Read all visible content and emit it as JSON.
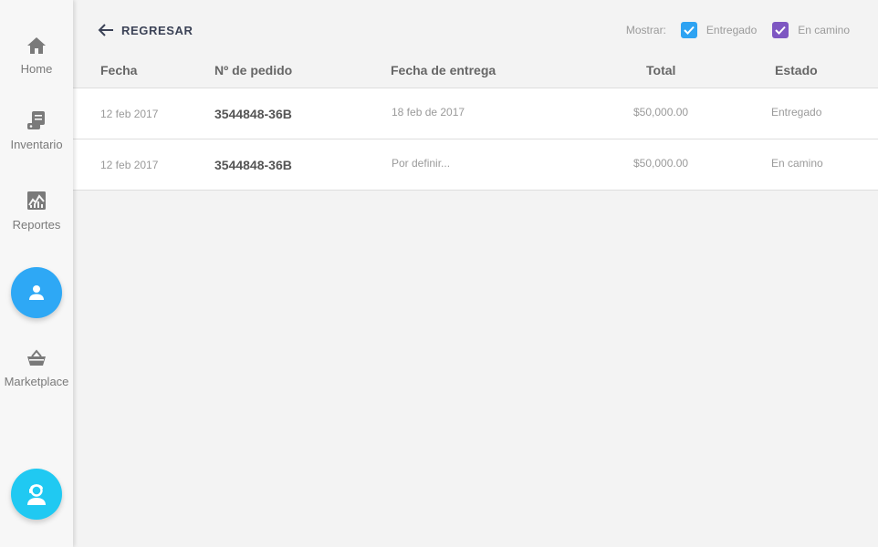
{
  "sidebar": {
    "items": [
      {
        "label": "Home",
        "icon": "home-icon"
      },
      {
        "label": "Inventario",
        "icon": "inventory-icon"
      },
      {
        "label": "Reportes",
        "icon": "reports-icon"
      },
      {
        "label": "Marketplace",
        "icon": "basket-icon"
      }
    ],
    "profile_button": {
      "icon": "person-icon",
      "color": "#2ea8f5"
    },
    "support_button": {
      "icon": "support-agent-icon",
      "color": "#20c9f2"
    }
  },
  "toolbar": {
    "back_label": "REGRESAR",
    "filter_label": "Mostrar:",
    "filters": [
      {
        "label": "Entregado",
        "checked": true,
        "color": "#2ea3f2"
      },
      {
        "label": "En camino",
        "checked": true,
        "color": "#7e57c2"
      }
    ]
  },
  "table": {
    "columns": [
      "Fecha",
      "Nº de pedido",
      "Fecha de entrega",
      "Total",
      "Estado"
    ],
    "rows": [
      {
        "fecha": "12 feb 2017",
        "pedido": "3544848-36B",
        "entrega": "18 feb de 2017",
        "total": "$50,000.00",
        "estado": "Entregado"
      },
      {
        "fecha": "12 feb 2017",
        "pedido": "3544848-36B",
        "entrega": "Por definir...",
        "total": "$50,000.00",
        "estado": "En camino"
      }
    ]
  }
}
